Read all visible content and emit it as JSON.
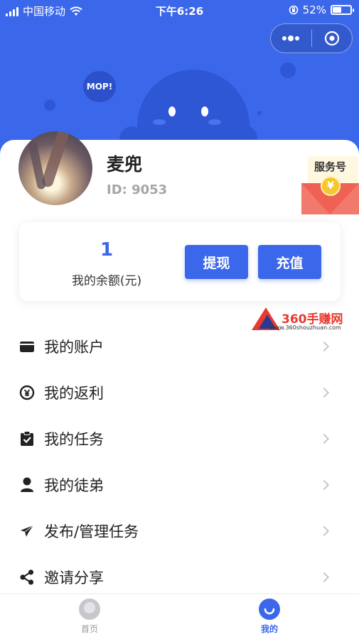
{
  "status_bar": {
    "carrier": "中国移动",
    "time": "下午6:26",
    "battery_percent": "52%",
    "battery_level": 0.52,
    "icons": [
      "signal-icon",
      "wifi-icon",
      "orientation-lock-icon",
      "battery-icon"
    ]
  },
  "mini_program_capsule": {
    "icons": [
      "more-dots-icon",
      "close-target-icon"
    ]
  },
  "header": {
    "mascot_badge": "MOP!",
    "accent_color": "#3b67ea"
  },
  "profile": {
    "name": "麦兜",
    "id_text": "ID: 9053"
  },
  "service": {
    "label": "服务号",
    "coin_symbol": "¥"
  },
  "balance": {
    "value": "1",
    "label": "我的余额(元)",
    "withdraw_label": "提现",
    "recharge_label": "充值"
  },
  "watermark": {
    "brand": "360手赚网",
    "url": "www.360shouzhuan.com"
  },
  "menu": {
    "items": [
      {
        "label": "我的账户",
        "icon": "wallet-icon"
      },
      {
        "label": "我的返利",
        "icon": "rebate-icon"
      },
      {
        "label": "我的任务",
        "icon": "clipboard-icon"
      },
      {
        "label": "我的徒弟",
        "icon": "user-icon"
      },
      {
        "label": "发布/管理任务",
        "icon": "send-icon"
      },
      {
        "label": "邀请分享",
        "icon": "share-icon"
      }
    ]
  },
  "tabbar": {
    "home_label": "首页",
    "mine_label": "我的",
    "active_tab": "我的"
  }
}
